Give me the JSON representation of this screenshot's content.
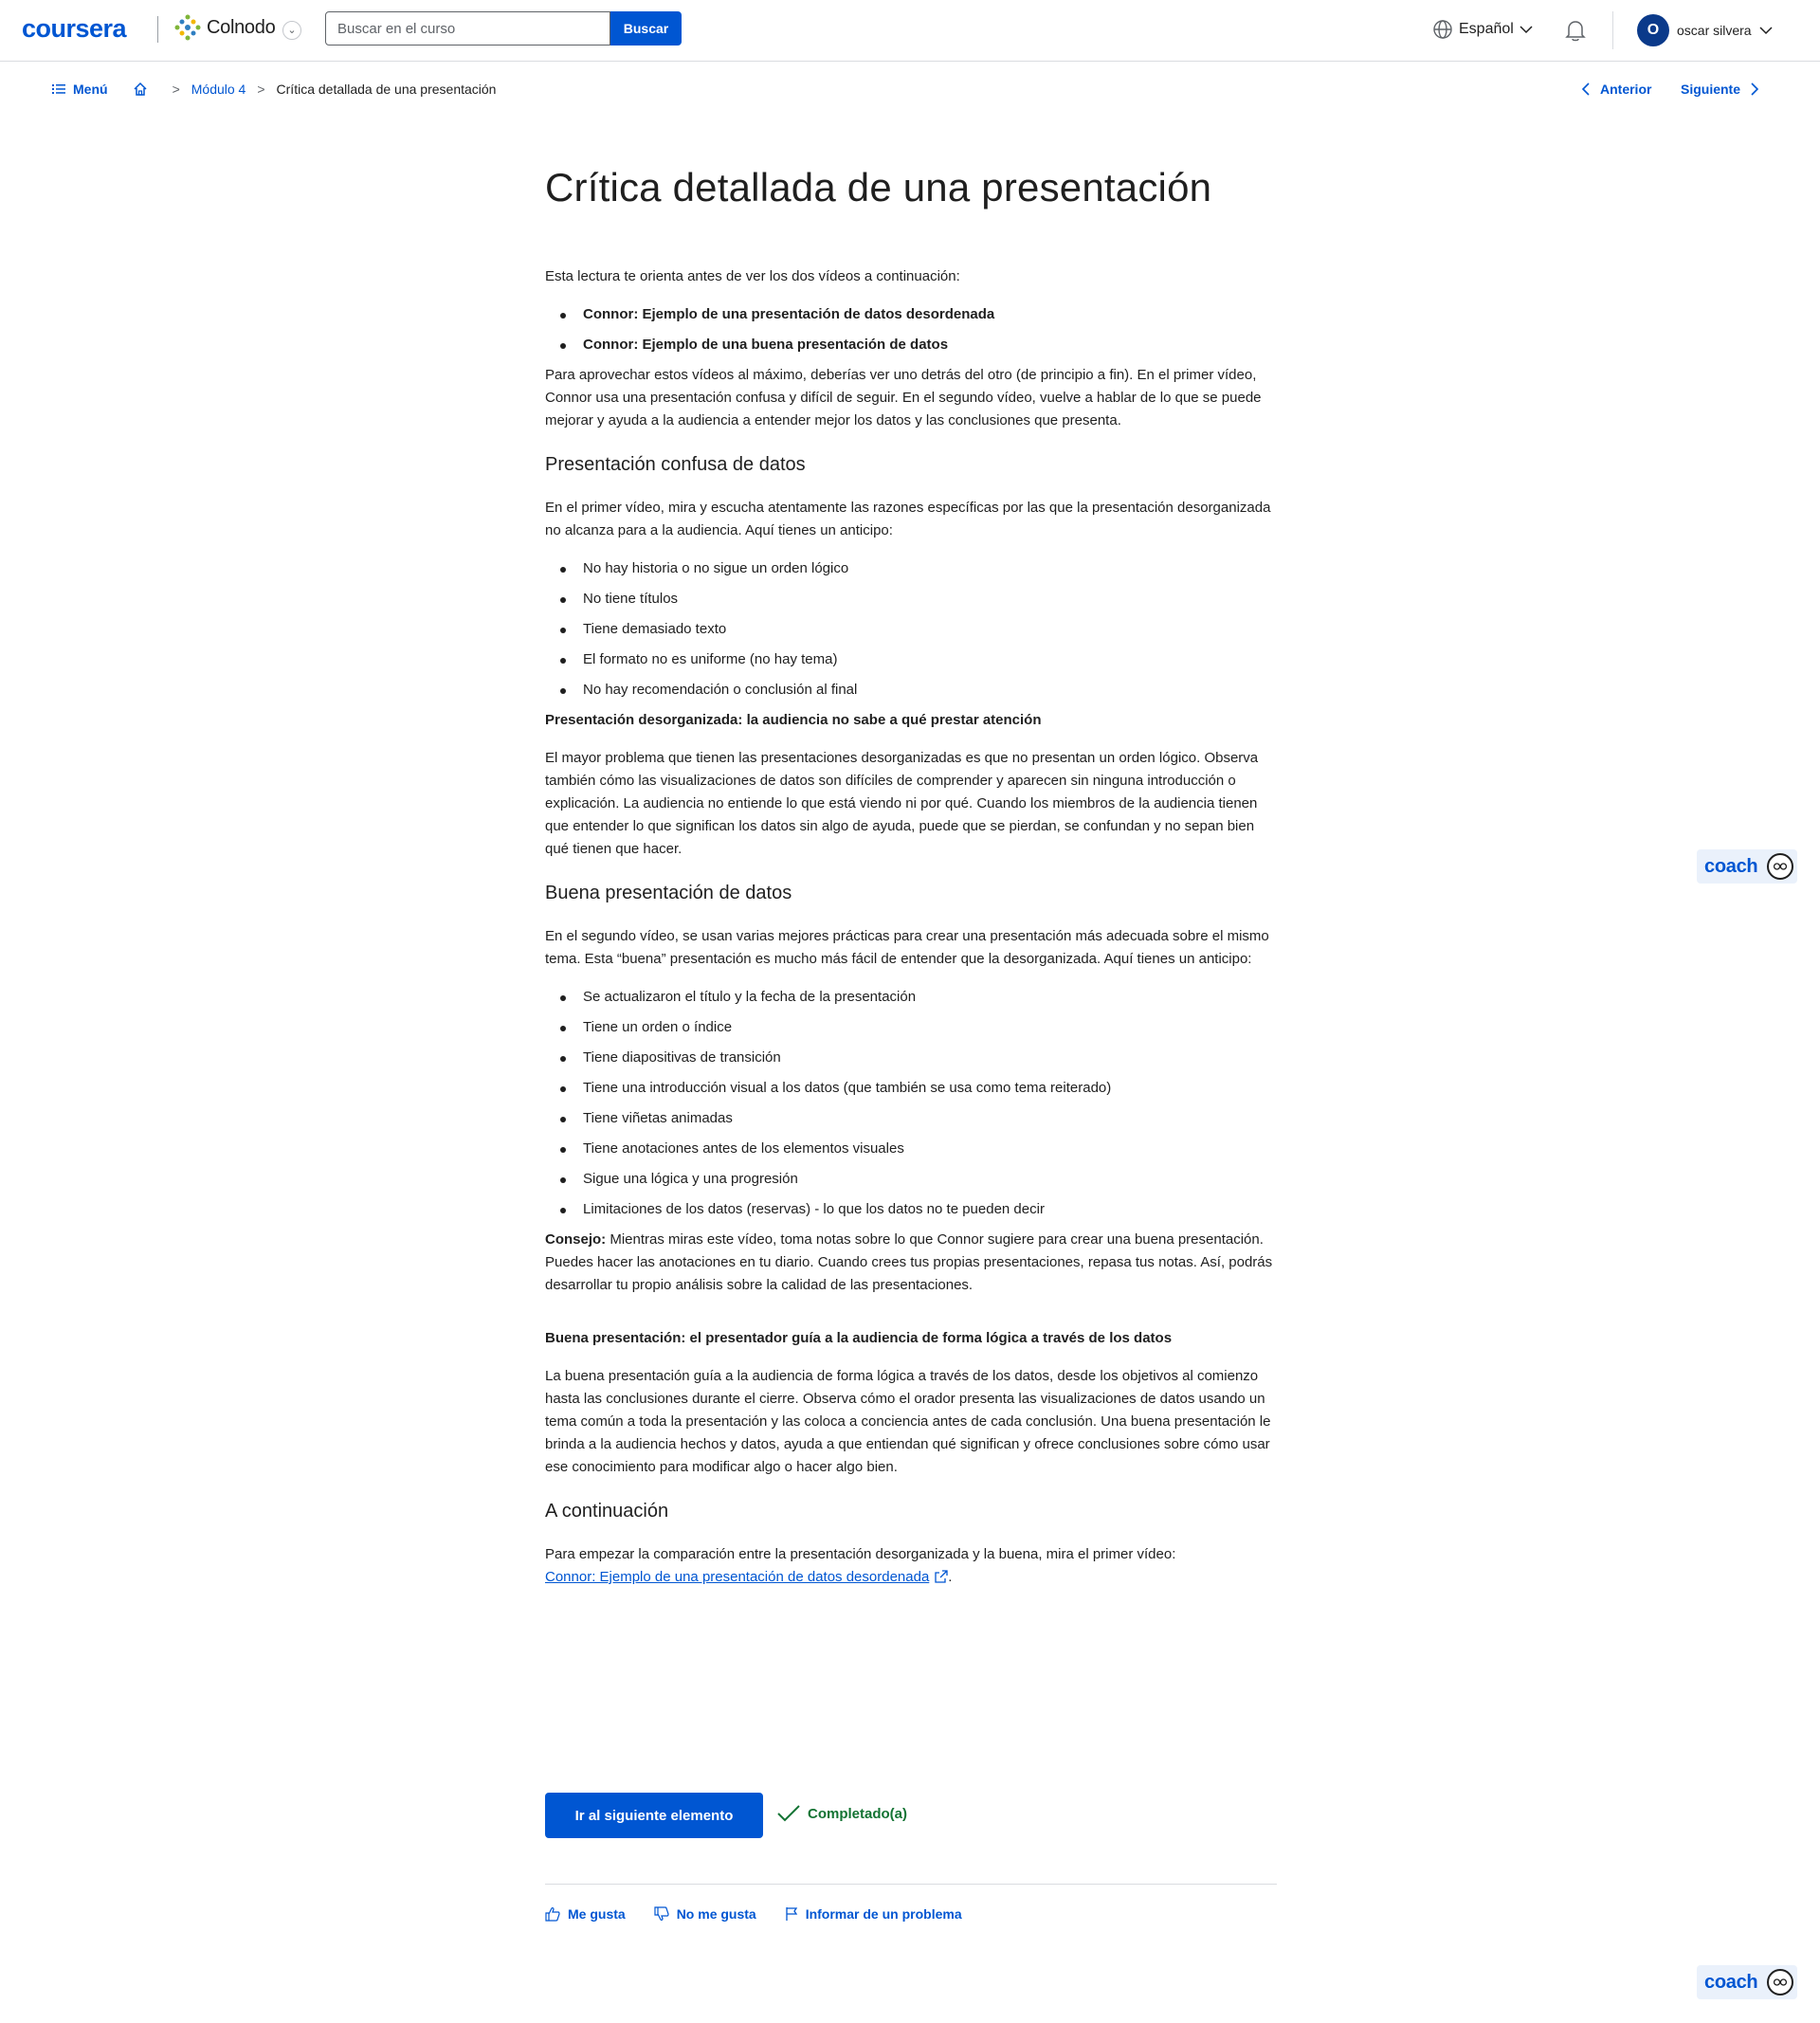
{
  "header": {
    "logo": "coursera",
    "partner_name": "Colnodo",
    "search_placeholder": "Buscar en el curso",
    "search_button": "Buscar",
    "language": "Español",
    "user_initial": "O",
    "user_name": "oscar silvera"
  },
  "breadcrumb": {
    "menu_label": "Menú",
    "module": "Módulo 4",
    "current": "Crítica detallada de una presentación",
    "prev_label": "Anterior",
    "next_label": "Siguiente"
  },
  "page": {
    "title": "Crítica detallada de una presentación",
    "intro": "Esta lectura te orienta antes de ver los dos vídeos a continuación:",
    "intro_items": [
      "Connor: Ejemplo de una presentación de datos desordenada",
      "Connor: Ejemplo de una buena presentación de datos"
    ],
    "intro_para": "Para aprovechar estos vídeos al máximo, deberías ver uno detrás del otro (de principio a fin). En el primer vídeo, Connor usa una presentación confusa y difícil de seguir. En el segundo vídeo, vuelve a hablar de lo que se puede mejorar y ayuda a la audiencia a entender mejor los datos y las conclusiones que presenta.",
    "section1": {
      "heading": "Presentación confusa de datos",
      "para": "En el primer vídeo, mira y escucha atentamente las razones específicas por las que la presentación desorganizada no alcanza para a la audiencia. Aquí tienes un anticipo:",
      "items": [
        "No hay historia o no sigue un orden lógico",
        "No tiene títulos",
        "Tiene demasiado texto",
        "El formato no es uniforme (no hay tema)",
        "No hay recomendación o conclusión al final"
      ],
      "subheading": "Presentación desorganizada: la audiencia no sabe a qué prestar atención",
      "subpara": "El mayor problema que tienen las presentaciones desorganizadas es que no presentan un orden lógico. Observa también cómo las visualizaciones de datos son difíciles de comprender y aparecen sin ninguna introducción o explicación. La audiencia no entiende lo que está viendo ni por qué.  Cuando los miembros de la audiencia tienen que entender lo que significan los datos sin algo de ayuda, puede que se pierdan, se confundan y no sepan bien qué tienen que hacer."
    },
    "section2": {
      "heading": "Buena presentación de datos",
      "para": "En el segundo vídeo, se usan varias mejores prácticas para crear una presentación más adecuada sobre el mismo tema. Esta “buena” presentación es mucho más fácil de entender que la desorganizada. Aquí tienes un anticipo:",
      "items": [
        "Se actualizaron el título y la fecha de la presentación",
        "Tiene un orden o índice",
        "Tiene diapositivas de transición",
        "Tiene una introducción visual a los datos (que también se usa como tema reiterado)",
        "Tiene viñetas animadas",
        "Tiene anotaciones antes de los elementos visuales",
        "Sigue una lógica y una progresión",
        "Limitaciones de los datos (reservas) - lo que los datos no te pueden decir"
      ],
      "tip_label": "Consejo:",
      "tip_text": " Mientras miras este vídeo, toma notas sobre lo que Connor sugiere para crear una buena presentación. Puedes hacer las anotaciones en tu diario. Cuando crees tus propias presentaciones, repasa tus notas. Así, podrás desarrollar tu propio análisis sobre la calidad de las presentaciones.",
      "subheading": "Buena presentación: el presentador guía a la audiencia de forma lógica a través de los datos",
      "subpara": "La buena presentación guía a la audiencia de forma lógica a través de los datos, desde los objetivos al comienzo hasta las conclusiones durante el cierre. Observa cómo el orador presenta las visualizaciones de datos usando un tema común a toda la presentación y las coloca a conciencia antes de cada conclusión. Una buena presentación le brinda a la audiencia hechos y datos, ayuda a que entiendan qué significan y ofrece conclusiones sobre cómo usar ese conocimiento para modificar algo o hacer algo bien."
    },
    "section3": {
      "heading": "A continuación",
      "para": "Para empezar la comparación entre la presentación desorganizada y la buena, mira el primer vídeo:",
      "link": "Connor: Ejemplo de una presentación de datos desordenada",
      "link_suffix": "."
    }
  },
  "actions": {
    "next_button": "Ir al siguiente elemento",
    "completed": "Completado(a)",
    "like": "Me gusta",
    "dislike": "No me gusta",
    "report": "Informar de un problema"
  },
  "coach": {
    "label": "coach"
  },
  "colors": {
    "accent": "#0056d2",
    "success": "#137333",
    "text": "#1f1f1f"
  }
}
